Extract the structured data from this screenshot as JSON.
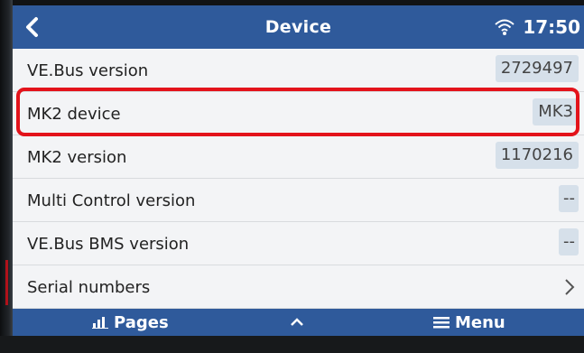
{
  "header": {
    "title": "Device",
    "time": "17:50"
  },
  "icons": {
    "back": "chevron-left-icon",
    "wifi": "wifi-icon",
    "pages": "bar-chart-icon",
    "up": "chevron-up-icon",
    "menu": "hamburger-menu-icon",
    "more": "chevron-right-icon"
  },
  "colors": {
    "header": "#2f5a9b",
    "highlight": "#e3131b",
    "value_box": "#d6e0ea"
  },
  "rows": [
    {
      "label": "VE.Bus version",
      "value": "2729497"
    },
    {
      "label": "MK2 device",
      "value": "MK3"
    },
    {
      "label": "MK2 version",
      "value": "1170216"
    },
    {
      "label": "Multi Control version",
      "value": "--"
    },
    {
      "label": "VE.Bus BMS version",
      "value": "--"
    },
    {
      "label": "Serial numbers",
      "value": ""
    }
  ],
  "footer": {
    "pages_label": "Pages",
    "menu_label": "Menu"
  }
}
